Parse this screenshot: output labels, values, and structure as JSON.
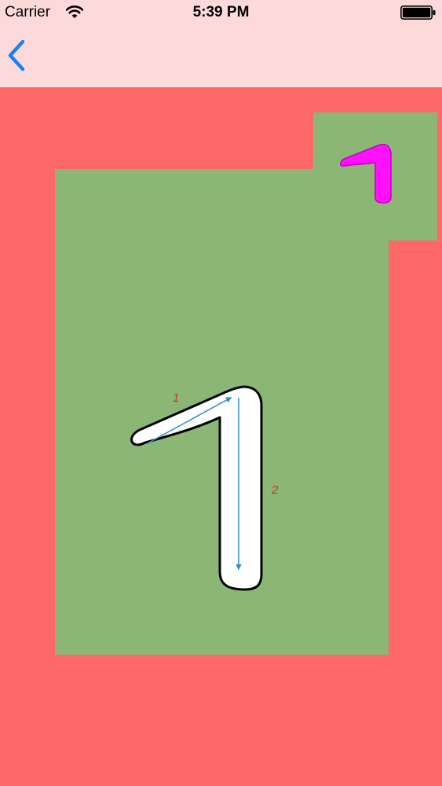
{
  "status_bar": {
    "carrier": "Carrier",
    "time": "5:39 PM"
  },
  "nav": {
    "back_icon": "chevron-left-icon"
  },
  "tracing": {
    "stroke_labels": [
      "1",
      "2"
    ]
  },
  "colors": {
    "header_background": "#fddada",
    "content_background": "#ff6868",
    "board_background": "#8bb673",
    "back_button": "#1a7ef5",
    "stroke_arrow": "#2a8fd0",
    "stroke_label": "#d0302f",
    "preview_digit": "#ff10ff"
  }
}
